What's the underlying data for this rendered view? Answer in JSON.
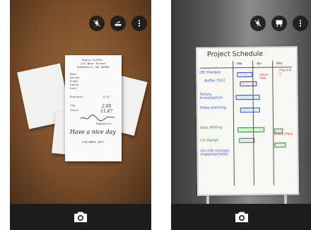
{
  "colors": {
    "toolbar_button_bg": "#191919",
    "bottom_bar_bg": "#1d1d1d",
    "icon_white": "#ffffff",
    "marker_black": "#333333",
    "marker_blue": "#3a55c8",
    "marker_green": "#2f8f3a",
    "marker_red": "#d2322d"
  },
  "left_screen": {
    "toolbar_icons": [
      "flash-off-icon",
      "scan-mode-icon",
      "more-vert-icon"
    ],
    "receipt": {
      "lines": [
        "Koala Coffee",
        "475 West Street",
        "Somewhere, WA 98000",
        "Date",
        "Server",
        "Order",
        "Table",
        "Card",
        "Subtotal",
        "Tip",
        "Total",
        "Signature"
      ],
      "subtotal_value": "9.47",
      "tip_value": "2.00",
      "total_value": "11.47",
      "handwriting": "Have a nice day",
      "customer_copy": "CUSTOMER COPY"
    },
    "bottom_icon": "camera-icon"
  },
  "right_screen": {
    "toolbar_icons": [
      "flash-off-icon",
      "whiteboard-mode-icon",
      "more-vert-icon"
    ],
    "whiteboard": {
      "title": "Project Schedule",
      "months": [
        "Mar",
        "Apr",
        "May"
      ],
      "rows": [
        "DB changes",
        "Buffer TEST",
        "Failure Investigation",
        "Video planning",
        "Spec Writing",
        "UX Design",
        "UX+DB changes Implementation"
      ],
      "note_plan": "Plan A B C",
      "note_check": "check Plan",
      "note_review": "Review (Plan)"
    },
    "bottom_icon": "camera-icon"
  }
}
